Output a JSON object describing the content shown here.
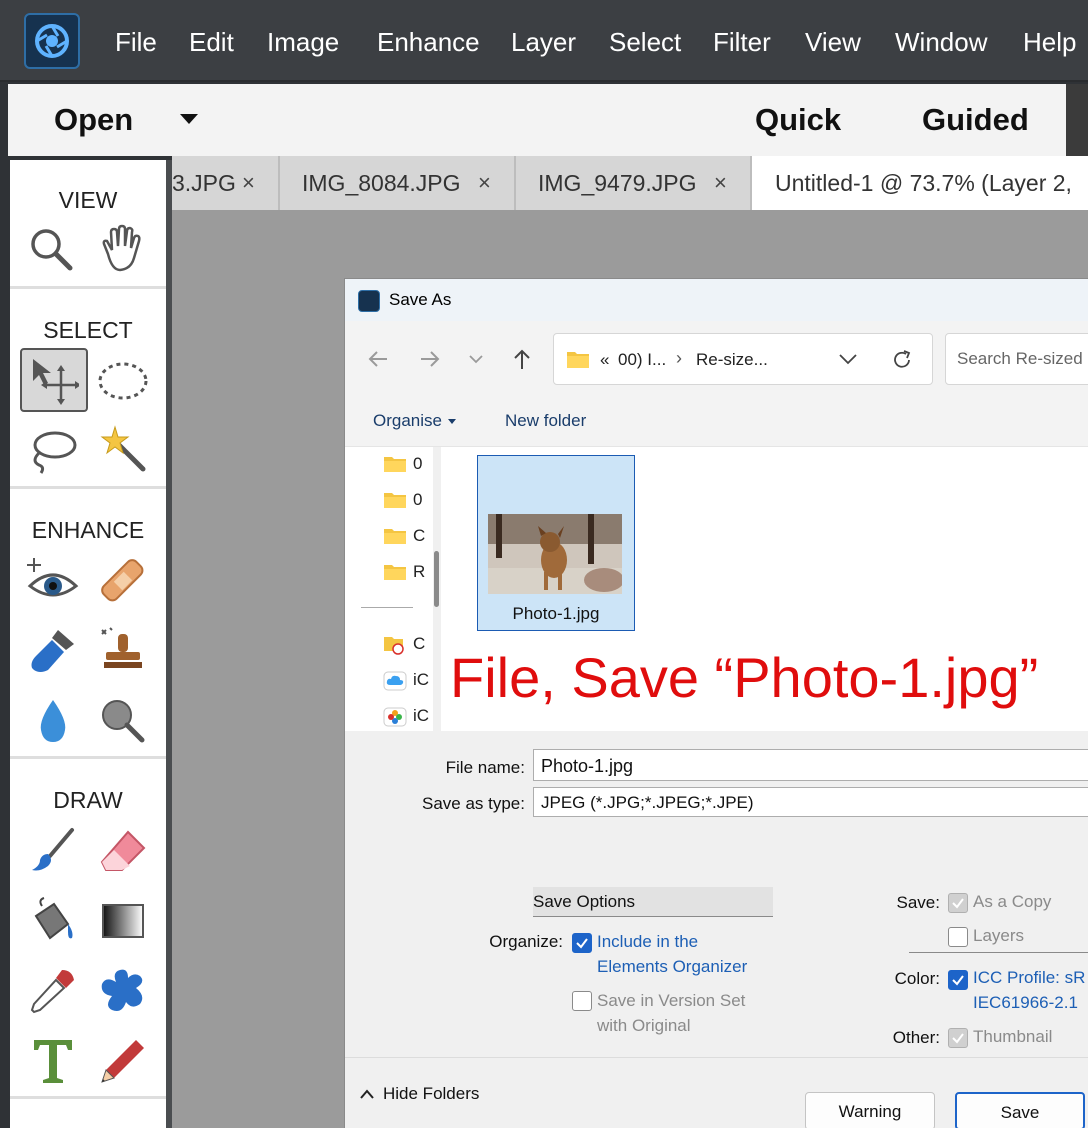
{
  "app": {
    "menu": [
      "File",
      "Edit",
      "Image",
      "Enhance",
      "Layer",
      "Select",
      "Filter",
      "View",
      "Window",
      "Help"
    ]
  },
  "options_bar": {
    "open_label": "Open",
    "modes": [
      "Quick",
      "Guided"
    ]
  },
  "toolbox": {
    "sections": [
      {
        "title": "VIEW"
      },
      {
        "title": "SELECT"
      },
      {
        "title": "ENHANCE"
      },
      {
        "title": "DRAW"
      }
    ]
  },
  "tabs": [
    {
      "label": "3.JPG",
      "close": "×"
    },
    {
      "label": "IMG_8084.JPG",
      "close": "×"
    },
    {
      "label": "IMG_9479.JPG",
      "close": "×"
    },
    {
      "label": "Untitled-1 @ 73.7% (Layer 2,",
      "close": ""
    }
  ],
  "dialog": {
    "title": "Save As",
    "address": {
      "chevrons": "«",
      "crumb1": "00) I...",
      "sep": "›",
      "crumb2": "Re-size..."
    },
    "search_placeholder": "Search Re-sized p",
    "commands": {
      "organise": "Organise",
      "new_folder": "New folder"
    },
    "nav_items": [
      "0",
      "0",
      "C",
      "R",
      "C",
      "iC",
      "iC"
    ],
    "file": {
      "name": "Photo-1.jpg"
    },
    "annotation": "File, Save “Photo-1.jpg”",
    "form": {
      "file_name_label": "File name:",
      "file_name_value": "Photo-1.jpg",
      "type_label": "Save as type:",
      "type_value": "JPEG (*.JPG;*.JPEG;*.JPE)",
      "save_options": "Save Options",
      "organize_label": "Organize:",
      "include_line1": "Include in the",
      "include_line2": "Elements Organizer",
      "version_line1": "Save in Version Set",
      "version_line2": "with Original",
      "save_label": "Save:",
      "as_copy": "As a Copy",
      "layers": "Layers",
      "color_label": "Color:",
      "icc_line1": "ICC Profile:  sR",
      "icc_line2": "IEC61966-2.1",
      "other_label": "Other:",
      "thumbnail": "Thumbnail"
    },
    "buttons": {
      "hide_folders": "Hide Folders",
      "warning": "Warning",
      "save": "Save"
    }
  },
  "colors": {
    "accent": "#1d64c9",
    "annotation": "#e00d0d",
    "menubar": "#3c3f43"
  }
}
